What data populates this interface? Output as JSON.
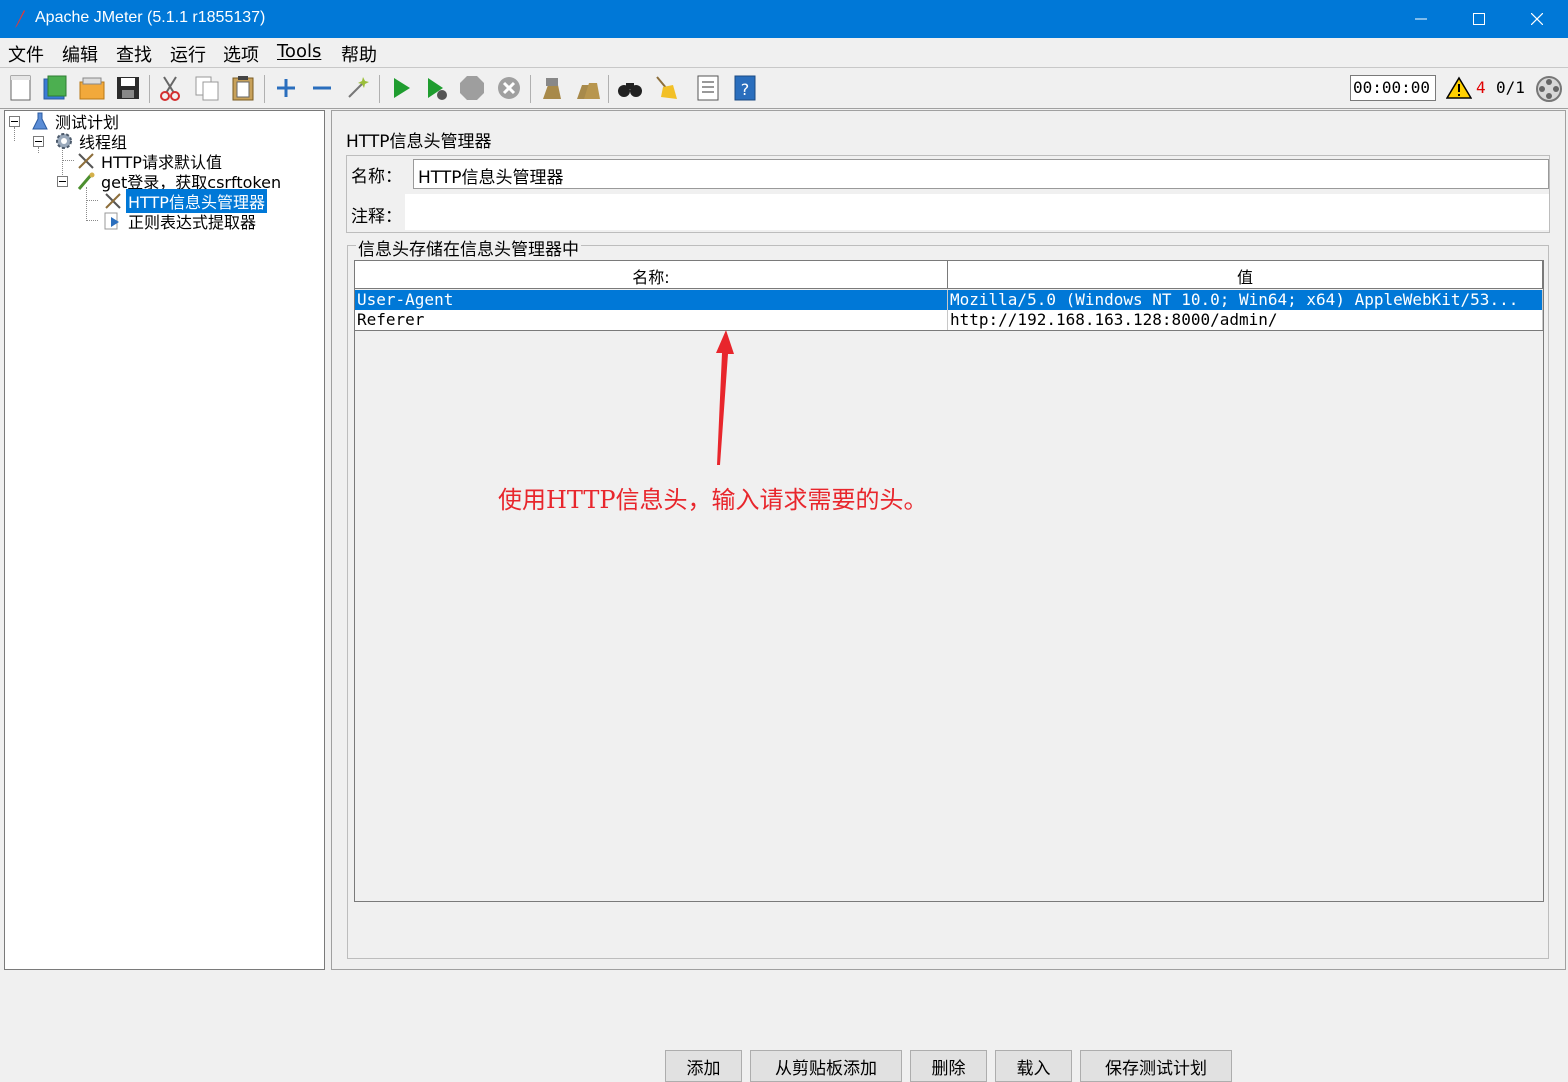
{
  "window": {
    "title": "Apache JMeter (5.1.1 r1855137)"
  },
  "menu": [
    "文件",
    "编辑",
    "查找",
    "运行",
    "选项",
    "Tools",
    "帮助"
  ],
  "toolbar": {
    "timer": "00:00:00",
    "warning_count": "4",
    "thread_count": "0/1"
  },
  "tree": {
    "nodes": [
      {
        "label": "测试计划"
      },
      {
        "label": "线程组"
      },
      {
        "label": "HTTP请求默认值"
      },
      {
        "label": "get登录，获取csrftoken"
      },
      {
        "label": "HTTP信息头管理器"
      },
      {
        "label": "正则表达式提取器"
      }
    ]
  },
  "panel": {
    "title": "HTTP信息头管理器",
    "name_label": "名称：",
    "name_value": "HTTP信息头管理器",
    "comment_label": "注释：",
    "group_title": "信息头存储在信息头管理器中",
    "table": {
      "columns": [
        "名称:",
        "值"
      ],
      "rows": [
        {
          "name": "User-Agent",
          "value": "Mozilla/5.0 (Windows NT 10.0; Win64; x64) AppleWebKit/53..."
        },
        {
          "name": "Referer",
          "value": "http://192.168.163.128:8000/admin/"
        }
      ]
    },
    "buttons": {
      "add": "添加",
      "add_clipboard": "从剪贴板添加",
      "delete": "删除",
      "load": "载入",
      "save": "保存测试计划"
    }
  },
  "annotation": {
    "text": "使用HTTP信息头，输入请求需要的头。",
    "color": "#e8262c"
  },
  "colors": {
    "titlebar": "#0078d7",
    "selection": "#0078d7"
  }
}
